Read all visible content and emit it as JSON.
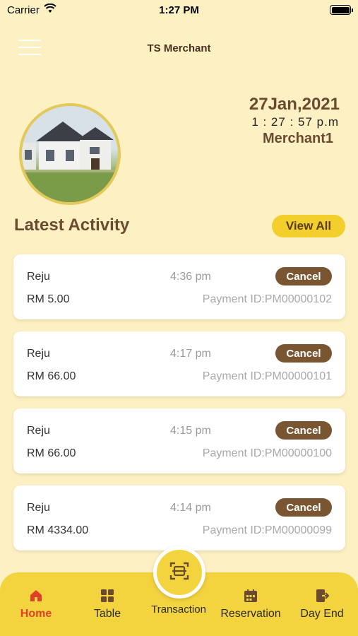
{
  "status_bar": {
    "carrier": "Carrier",
    "time": "1:27 PM"
  },
  "header": {
    "title": "TS Merchant"
  },
  "profile": {
    "date": "27Jan,2021",
    "time": "1 : 27 : 57 p.m",
    "merchant": "Merchant1"
  },
  "activity": {
    "title": "Latest Activity",
    "view_all_label": "View All",
    "items": [
      {
        "name": "Reju",
        "time": "4:36 pm",
        "amount": "RM 5.00",
        "payment_id": "Payment ID:PM00000102",
        "cancel_label": "Cancel"
      },
      {
        "name": "Reju",
        "time": "4:17 pm",
        "amount": "RM 66.00",
        "payment_id": "Payment ID:PM00000101",
        "cancel_label": "Cancel"
      },
      {
        "name": "Reju",
        "time": "4:15 pm",
        "amount": "RM 66.00",
        "payment_id": "Payment ID:PM00000100",
        "cancel_label": "Cancel"
      },
      {
        "name": "Reju",
        "time": "4:14 pm",
        "amount": "RM 4334.00",
        "payment_id": "Payment ID:PM00000099",
        "cancel_label": "Cancel"
      }
    ]
  },
  "nav": {
    "home": "Home",
    "table": "Table",
    "transaction": "Transaction",
    "reservation": "Reservation",
    "day_end": "Day End"
  },
  "colors": {
    "background": "#fdf1c4",
    "accent_yellow": "#f3d43f",
    "brown": "#7a5532",
    "active_nav": "#e0402a"
  },
  "icons": {
    "menu": "hamburger-menu-icon",
    "home": "home-icon",
    "table": "grid-icon",
    "transaction": "scan-icon",
    "reservation": "calendar-icon",
    "day_end": "exit-icon"
  }
}
